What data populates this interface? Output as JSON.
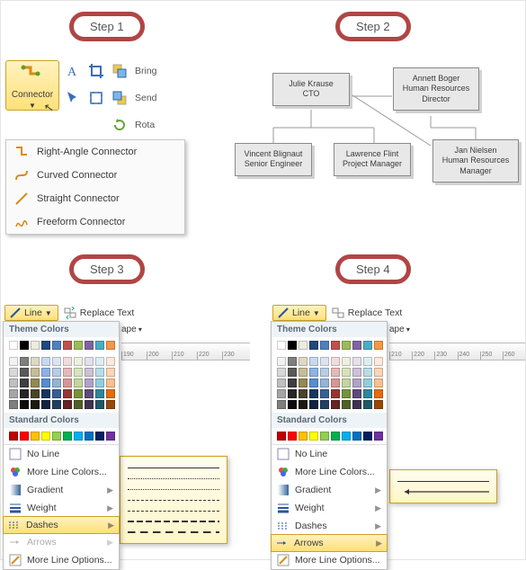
{
  "steps": {
    "s1": "Step 1",
    "s2": "Step 2",
    "s3": "Step 3",
    "s4": "Step 4"
  },
  "connector": {
    "button_label": "Connector",
    "ribbon": [
      {
        "icon": "bring-front-icon",
        "label": "Bring"
      },
      {
        "icon": "send-back-icon",
        "label": "Send"
      },
      {
        "icon": "rotate-icon",
        "label": "Rota"
      }
    ],
    "menu": [
      {
        "icon": "right-angle-connector-icon",
        "label": "Right-Angle Connector"
      },
      {
        "icon": "curved-connector-icon",
        "label": "Curved Connector"
      },
      {
        "icon": "straight-connector-icon",
        "label": "Straight Connector"
      },
      {
        "icon": "freeform-connector-icon",
        "label": "Freeform Connector"
      }
    ]
  },
  "org": {
    "boxes": [
      {
        "name": "Julie Krause",
        "role": "CTO"
      },
      {
        "name": "Annett Boger",
        "role": "Human Resources Director"
      },
      {
        "name": "Vincent Blignaut",
        "role": "Senior Engineer"
      },
      {
        "name": "Lawrence Flint",
        "role": "Project Manager"
      },
      {
        "name": "Jan Nielsen",
        "role": "Human Resources Manager"
      }
    ]
  },
  "line_panel": {
    "line_btn": "Line",
    "replace_text": "Replace Text",
    "shape": "ape",
    "theme_title": "Theme Colors",
    "standard_title": "Standard Colors",
    "options": [
      {
        "icon": "no-line-icon",
        "label": "No Line"
      },
      {
        "icon": "more-colors-icon",
        "label": "More Line Colors..."
      },
      {
        "icon": "gradient-icon",
        "label": "Gradient",
        "sub": true
      },
      {
        "icon": "weight-icon",
        "label": "Weight",
        "sub": true
      },
      {
        "icon": "dashes-icon",
        "label": "Dashes",
        "sub": true
      },
      {
        "icon": "arrows-icon",
        "label": "Arrows",
        "sub": true
      },
      {
        "icon": "more-options-icon",
        "label": "More Line Options..."
      }
    ],
    "ruler_ticks": [
      "190",
      "200",
      "210",
      "220",
      "230",
      "240",
      "250",
      "260"
    ],
    "ruler_ticks_4": [
      "210",
      "220",
      "230",
      "240",
      "250",
      "260"
    ]
  }
}
